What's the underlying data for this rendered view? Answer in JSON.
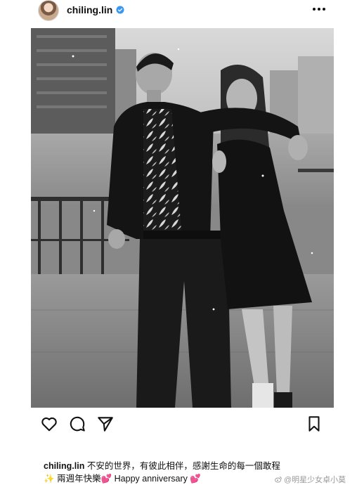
{
  "header": {
    "username": "chiling.lin",
    "avatar_icon": "avatar-photo",
    "verified_icon": "verified-badge-icon",
    "more_icon": "more-dots-icon",
    "verified_color": "#3897f0"
  },
  "post": {
    "image_description_icon": "photo",
    "actions": {
      "like_icon": "heart-icon",
      "comment_icon": "comment-icon",
      "share_icon": "send-icon",
      "save_icon": "bookmark-icon"
    }
  },
  "caption": {
    "username": "chiling.lin",
    "line1": "不安的世界，有彼此相伴，感謝生命的每一個敢程",
    "sparkle": "✨",
    "line2_a": "兩週年快樂",
    "heart1": "💕",
    "line2_b": "Happy anniversary",
    "heart2": "💕"
  },
  "watermark": {
    "text": "@明星少女卓小莫"
  }
}
